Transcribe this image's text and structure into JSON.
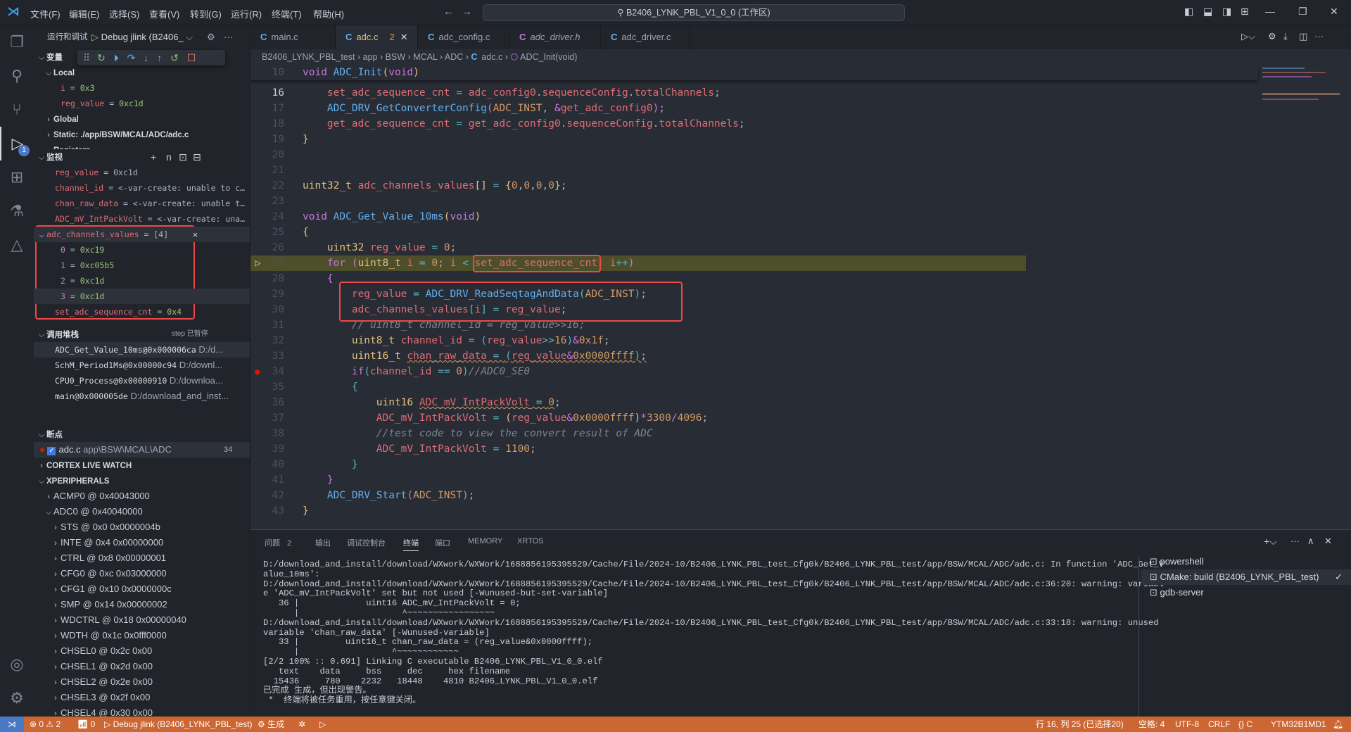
{
  "colors": {
    "accent": "#cc6633",
    "remote": "#4a78c4",
    "breakpoint": "#e51400",
    "highlight_line": "#4d4f2a",
    "annotation_box": "#f04848"
  },
  "titlebar": {
    "menus": [
      "文件(F)",
      "编辑(E)",
      "选择(S)",
      "查看(V)",
      "转到(G)",
      "运行(R)",
      "终端(T)",
      "帮助(H)"
    ],
    "search": "B2406_LYNK_PBL_V1_0_0 (工作区)",
    "back": "←",
    "forward": "→"
  },
  "activity": {
    "items": [
      "files-icon",
      "search-icon",
      "source-control-icon",
      "run-debug-icon",
      "extensions-icon",
      "testing-icon",
      "cmake-icon"
    ],
    "debug_badge": "1",
    "bottom": [
      "account-icon",
      "settings-icon"
    ]
  },
  "sidebar": {
    "title": "运行和调试",
    "config": "Debug jlink (B2406_",
    "variables": {
      "title": "变量",
      "local": "Local",
      "items": [
        {
          "name": "i",
          "value": "0x3"
        },
        {
          "name": "reg_value",
          "value": "0xc1d"
        }
      ],
      "global": "Global",
      "static": "Static: ./app/BSW/MCAL/ADC/adc.c",
      "registers": "Registers"
    },
    "watch": {
      "title": "监视",
      "items": [
        {
          "name": "reg_value",
          "value": "= 0xc1d"
        },
        {
          "name": "channel_id",
          "value": "= <-var-create: unable to c…"
        },
        {
          "name": "chan_raw_data",
          "value": "= <-var-create: unable t…"
        },
        {
          "name": "ADC_mV_IntPackVolt",
          "value": "= <-var-create: una…"
        }
      ],
      "array": {
        "name": "adc_channels_values",
        "value": "= [4]",
        "children": [
          {
            "name": "0",
            "value": "0xc19"
          },
          {
            "name": "1",
            "value": "0xc05b5"
          },
          {
            "name": "2",
            "value": "0xc1d"
          },
          {
            "name": "3",
            "value": "0xc1d"
          }
        ]
      },
      "last": {
        "name": "set_adc_sequence_cnt",
        "value": "= 0x4"
      }
    },
    "callstack": {
      "title": "调用堆栈",
      "status": "step 已暂停",
      "frames": [
        {
          "fn": "ADC_Get_Value_10ms@0x000006ca",
          "path": "D:/d..."
        },
        {
          "fn": "SchM_Period1Ms@0x00000c94",
          "path": "D:/downl..."
        },
        {
          "fn": "CPU0_Process@0x00000910",
          "path": "D:/downloa..."
        },
        {
          "fn": "main@0x000005de",
          "path": "D:/download_and_inst..."
        }
      ]
    },
    "breakpoints": {
      "title": "断点",
      "items": [
        {
          "file": "adc.c",
          "path": "app\\BSW\\MCAL\\ADC",
          "line": "34"
        }
      ]
    },
    "cortex": "CORTEX LIVE WATCH",
    "xperipherals": {
      "title": "XPERIPHERALS",
      "top": [
        {
          "label": "ACMP0 @ 0x40043000",
          "expanded": false
        },
        {
          "label": "ADC0 @ 0x40040000",
          "expanded": true
        }
      ],
      "regs": [
        "STS @ 0x0 0x0000004b",
        "INTE @ 0x4 0x00000000",
        "CTRL @ 0x8 0x00000001",
        "CFG0 @ 0xc 0x03000000",
        "CFG1 @ 0x10 0x0000000c",
        "SMP @ 0x14 0x00000002",
        "WDCTRL @ 0x18 0x00000040",
        "WDTH @ 0x1c 0x0fff0000",
        "CHSEL0 @ 0x2c 0x00",
        "CHSEL1 @ 0x2d 0x00",
        "CHSEL2 @ 0x2e 0x00",
        "CHSEL3 @ 0x2f 0x00",
        "CHSEL4 @ 0x30 0x00"
      ]
    }
  },
  "tabs": [
    {
      "label": "main.c",
      "italic": false
    },
    {
      "label": "adc.c",
      "active": true,
      "problems": "2"
    },
    {
      "label": "adc_config.c"
    },
    {
      "label": "adc_driver.h",
      "italic": true
    },
    {
      "label": "adc_driver.c"
    }
  ],
  "breadcrumb": [
    "B2406_LYNK_PBL_test",
    "app",
    "BSW",
    "MCAL",
    "ADC",
    "adc.c",
    "ADC_Init(void)"
  ],
  "editor": {
    "current_line": "27",
    "breakpoint_line": "34",
    "lines": [
      {
        "n": "10",
        "sticky": true,
        "t": [
          [
            "kw",
            "void"
          ],
          [
            "p",
            " "
          ],
          [
            "fn",
            "ADC_Init"
          ],
          [
            "b1",
            "("
          ],
          [
            "kw",
            "void"
          ],
          [
            "b1",
            ")"
          ]
        ]
      },
      {
        "n": "16",
        "t": [
          [
            "p",
            "    "
          ],
          [
            "var",
            "set_adc_sequence_cnt"
          ],
          [
            "op",
            " = "
          ],
          [
            "var",
            "adc_config0"
          ],
          [
            "p",
            "."
          ],
          [
            "var",
            "sequenceConfig"
          ],
          [
            "p",
            "."
          ],
          [
            "var",
            "totalChannels"
          ],
          [
            "p",
            ";"
          ]
        ]
      },
      {
        "n": "17",
        "t": [
          [
            "p",
            "    "
          ],
          [
            "fn",
            "ADC_DRV_GetConverterConfig"
          ],
          [
            "b2",
            "("
          ],
          [
            "num",
            "ADC_INST"
          ],
          [
            "p",
            ", "
          ],
          [
            "kw",
            "&"
          ],
          [
            "var",
            "get_adc_config0"
          ],
          [
            "b2",
            ")"
          ],
          [
            "p",
            ";"
          ]
        ]
      },
      {
        "n": "18",
        "t": [
          [
            "p",
            "    "
          ],
          [
            "var",
            "get_adc_sequence_cnt"
          ],
          [
            "op",
            " = "
          ],
          [
            "var",
            "get_adc_config0"
          ],
          [
            "p",
            "."
          ],
          [
            "var",
            "sequenceConfig"
          ],
          [
            "p",
            "."
          ],
          [
            "var",
            "totalChannels"
          ],
          [
            "p",
            ";"
          ]
        ]
      },
      {
        "n": "19",
        "t": [
          [
            "b1",
            "}"
          ]
        ]
      },
      {
        "n": "20",
        "t": []
      },
      {
        "n": "21",
        "t": []
      },
      {
        "n": "22",
        "t": [
          [
            "type",
            "uint32_t"
          ],
          [
            "p",
            " "
          ],
          [
            "var",
            "adc_channels_values"
          ],
          [
            "b1",
            "[]"
          ],
          [
            "op",
            " = "
          ],
          [
            "b1",
            "{"
          ],
          [
            "num",
            "0"
          ],
          [
            "p",
            ","
          ],
          [
            "num",
            "0"
          ],
          [
            "p",
            ","
          ],
          [
            "num",
            "0"
          ],
          [
            "p",
            ","
          ],
          [
            "num",
            "0"
          ],
          [
            "b1",
            "}"
          ],
          [
            "p",
            ";"
          ]
        ]
      },
      {
        "n": "23",
        "t": []
      },
      {
        "n": "24",
        "t": [
          [
            "kw",
            "void"
          ],
          [
            "p",
            " "
          ],
          [
            "fn",
            "ADC_Get_Value_10ms"
          ],
          [
            "b1",
            "("
          ],
          [
            "kw",
            "void"
          ],
          [
            "b1",
            ")"
          ]
        ]
      },
      {
        "n": "25",
        "t": [
          [
            "b1",
            "{"
          ]
        ]
      },
      {
        "n": "26",
        "t": [
          [
            "p",
            "    "
          ],
          [
            "type",
            "uint32"
          ],
          [
            "p",
            " "
          ],
          [
            "var",
            "reg_value"
          ],
          [
            "op",
            " = "
          ],
          [
            "num",
            "0"
          ],
          [
            "p",
            ";"
          ]
        ]
      },
      {
        "n": "27",
        "t": [
          [
            "p",
            "    "
          ],
          [
            "kw",
            "for"
          ],
          [
            "p",
            " "
          ],
          [
            "b2",
            "("
          ],
          [
            "type",
            "uint8_t"
          ],
          [
            "p",
            " "
          ],
          [
            "var",
            "i"
          ],
          [
            "op",
            " = "
          ],
          [
            "num",
            "0"
          ],
          [
            "p",
            "; "
          ],
          [
            "var",
            "i"
          ],
          [
            "op",
            " < "
          ],
          [
            "var",
            "set_adc_sequence_cnt"
          ],
          [
            "p",
            "; "
          ],
          [
            "var",
            "i"
          ],
          [
            "op",
            "++"
          ],
          [
            "b2",
            ")"
          ]
        ]
      },
      {
        "n": "28",
        "t": [
          [
            "p",
            "    "
          ],
          [
            "b2",
            "{"
          ]
        ]
      },
      {
        "n": "29",
        "t": [
          [
            "p",
            "        "
          ],
          [
            "var",
            "reg_value"
          ],
          [
            "op",
            " = "
          ],
          [
            "fn",
            "ADC_DRV_ReadSeqtagAndData"
          ],
          [
            "b3",
            "("
          ],
          [
            "num",
            "ADC_INST"
          ],
          [
            "b3",
            ")"
          ],
          [
            "p",
            ";"
          ]
        ]
      },
      {
        "n": "30",
        "t": [
          [
            "p",
            "        "
          ],
          [
            "var",
            "adc_channels_values"
          ],
          [
            "b3",
            "["
          ],
          [
            "var",
            "i"
          ],
          [
            "b3",
            "]"
          ],
          [
            "op",
            " = "
          ],
          [
            "var",
            "reg_value"
          ],
          [
            "p",
            ";"
          ]
        ]
      },
      {
        "n": "31",
        "t": [
          [
            "p",
            "        "
          ],
          [
            "cm",
            "// uint8_t channel_id = reg_value>>16;"
          ]
        ]
      },
      {
        "n": "32",
        "t": [
          [
            "p",
            "        "
          ],
          [
            "type",
            "uint8_t"
          ],
          [
            "p",
            " "
          ],
          [
            "var",
            "channel_id"
          ],
          [
            "op",
            " = "
          ],
          [
            "b3",
            "("
          ],
          [
            "var",
            "reg_value"
          ],
          [
            "op",
            ">>"
          ],
          [
            "num",
            "16"
          ],
          [
            "b3",
            ")"
          ],
          [
            "kw",
            "&"
          ],
          [
            "num",
            "0x1f"
          ],
          [
            "p",
            ";"
          ]
        ]
      },
      {
        "n": "33",
        "t": [
          [
            "p",
            "        "
          ],
          [
            "type",
            "uint16_t"
          ],
          [
            "p",
            " "
          ],
          [
            "var",
            "chan_raw_data",
            "sq"
          ],
          [
            "op",
            " = ",
            "sq"
          ],
          [
            "b3",
            "(",
            "sq"
          ],
          [
            "var",
            "reg_value",
            "sq"
          ],
          [
            "kw",
            "&",
            "sq"
          ],
          [
            "num",
            "0x0000ffff",
            "sq"
          ],
          [
            "b3",
            ")",
            "sq"
          ],
          [
            "p",
            ";",
            "sq"
          ]
        ]
      },
      {
        "n": "34",
        "t": [
          [
            "p",
            "        "
          ],
          [
            "kw",
            "if"
          ],
          [
            "b3",
            "("
          ],
          [
            "var",
            "channel_id"
          ],
          [
            "op",
            " == "
          ],
          [
            "num",
            "0"
          ],
          [
            "b3",
            ")"
          ],
          [
            "cm",
            "//ADC0_SE0"
          ]
        ]
      },
      {
        "n": "35",
        "t": [
          [
            "p",
            "        "
          ],
          [
            "b3",
            "{"
          ]
        ]
      },
      {
        "n": "36",
        "t": [
          [
            "p",
            "            "
          ],
          [
            "type",
            "uint16"
          ],
          [
            "p",
            " "
          ],
          [
            "var",
            "ADC_mV_IntPackVolt",
            "sq"
          ],
          [
            "op",
            " = ",
            "sq"
          ],
          [
            "num",
            "0",
            "sq"
          ],
          [
            "p",
            ";"
          ]
        ]
      },
      {
        "n": "37",
        "t": [
          [
            "p",
            "            "
          ],
          [
            "var",
            "ADC_mV_IntPackVolt"
          ],
          [
            "op",
            " = "
          ],
          [
            "b1",
            "("
          ],
          [
            "var",
            "reg_value"
          ],
          [
            "kw",
            "&"
          ],
          [
            "num",
            "0x0000ffff"
          ],
          [
            "b1",
            ")"
          ],
          [
            "kw",
            "*"
          ],
          [
            "num",
            "3300"
          ],
          [
            "kw",
            "/"
          ],
          [
            "num",
            "4096"
          ],
          [
            "p",
            ";"
          ]
        ]
      },
      {
        "n": "38",
        "t": [
          [
            "p",
            "            "
          ],
          [
            "cm",
            "//test code to view the convert result of ADC"
          ]
        ]
      },
      {
        "n": "39",
        "t": [
          [
            "p",
            "            "
          ],
          [
            "var",
            "ADC_mV_IntPackVolt"
          ],
          [
            "op",
            " = "
          ],
          [
            "num",
            "1100"
          ],
          [
            "p",
            ";"
          ]
        ]
      },
      {
        "n": "40",
        "t": [
          [
            "p",
            "        "
          ],
          [
            "b3",
            "}"
          ]
        ]
      },
      {
        "n": "41",
        "t": [
          [
            "p",
            "    "
          ],
          [
            "b2",
            "}"
          ]
        ]
      },
      {
        "n": "42",
        "t": [
          [
            "p",
            "    "
          ],
          [
            "fn",
            "ADC_DRV_Start"
          ],
          [
            "b2",
            "("
          ],
          [
            "num",
            "ADC_INST"
          ],
          [
            "b2",
            ")"
          ],
          [
            "p",
            ";"
          ]
        ]
      },
      {
        "n": "43",
        "t": [
          [
            "b1",
            "}"
          ]
        ]
      }
    ]
  },
  "panel": {
    "tabs": [
      {
        "label": "问题",
        "badge": "2"
      },
      {
        "label": "输出"
      },
      {
        "label": "调试控制台"
      },
      {
        "label": "终端",
        "active": true
      },
      {
        "label": "端口"
      },
      {
        "label": "MEMORY"
      },
      {
        "label": "XRTOS"
      }
    ],
    "terminal": [
      "D:/download_and_install/download/WXwork/WXWork/1688856195395529/Cache/File/2024-10/B2406_LYNK_PBL_test_Cfg0k/B2406_LYNK_PBL_test/app/BSW/MCAL/ADC/adc.c: In function 'ADC_Get_V",
      "alue_10ms':",
      "D:/download_and_install/download/WXwork/WXWork/1688856195395529/Cache/File/2024-10/B2406_LYNK_PBL_test_Cfg0k/B2406_LYNK_PBL_test/app/BSW/MCAL/ADC/adc.c:36:20: warning: variabl",
      "e 'ADC_mV_IntPackVolt' set but not used [-Wunused-but-set-variable]",
      "   36 |             uint16 ADC_mV_IntPackVolt = 0;",
      "      |                    ^~~~~~~~~~~~~~~~~~",
      "D:/download_and_install/download/WXwork/WXWork/1688856195395529/Cache/File/2024-10/B2406_LYNK_PBL_test_Cfg0k/B2406_LYNK_PBL_test/app/BSW/MCAL/ADC/adc.c:33:18: warning: unused",
      "variable 'chan_raw_data' [-Wunused-variable]",
      "   33 |         uint16_t chan_raw_data = (reg_value&0x0000ffff);",
      "      |                  ^~~~~~~~~~~~~",
      "[2/2 100% :: 0.691] Linking C executable B2406_LYNK_PBL_V1_0_0.elf",
      "   text    data     bss     dec     hex filename",
      "  15436     780    2232   18448    4810 B2406_LYNK_PBL_V1_0_0.elf",
      "已完成 生成，但出现警告。",
      " *  终端将被任务重用，按任意键关闭。"
    ],
    "terminals": [
      {
        "label": "powershell"
      },
      {
        "label": "CMake: build (B2406_LYNK_PBL_test)",
        "active": true,
        "check": "✓"
      },
      {
        "label": "gdb-server"
      }
    ]
  },
  "status": {
    "errors": "0",
    "warnings": "2",
    "ports": "0",
    "debug": "Debug jlink (B2406_LYNK_PBL_test)",
    "build": "生成",
    "position": "行 16, 列 25 (已选择20)",
    "spaces": "空格: 4",
    "encoding": "UTF-8",
    "eol": "CRLF",
    "language": "C",
    "target": "YTM32B1MD1"
  }
}
